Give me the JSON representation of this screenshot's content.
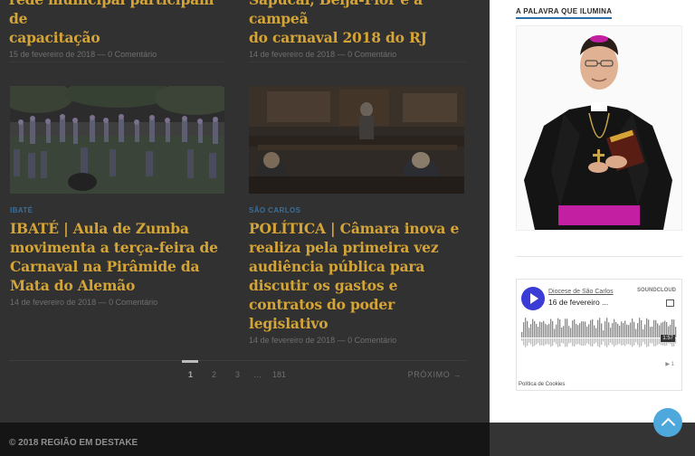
{
  "posts_top": [
    {
      "title_line1": "rede municipal participam de",
      "title_line2": "capacitação",
      "meta": "15 de fevereiro de 2018 — 0 Comentário"
    },
    {
      "title_line1": "Sapucaí, Beija-Flor é a campeã",
      "title_line2": "do carnaval 2018 do RJ",
      "meta": "14 de fevereiro de 2018 — 0 Comentário"
    }
  ],
  "posts": [
    {
      "category": "IBATÉ",
      "title": "IBATÉ | Aula de Zumba movimenta a terça-feira de Carnaval na Pirâmide da Mata do Alemão",
      "meta": "14 de fevereiro de 2018 — 0 Comentário"
    },
    {
      "category": "SÃO CARLOS",
      "title": "POLÍTICA | Câmara inova e realiza pela primeira vez audiência pública para discutir os gastos e contratos do poder legislativo",
      "meta": "14 de fevereiro de 2018 — 0 Comentário"
    }
  ],
  "pagination": {
    "pages": [
      "1",
      "2",
      "3",
      "…",
      "181"
    ],
    "next": "PRÓXIMO →"
  },
  "footer": {
    "copyright": "© 2018 REGIÃO EM DESTAKE"
  },
  "sidebar": {
    "widget_title": "A PALAVRA QUE ILUMINA",
    "soundcloud": {
      "artist": "Diocese de São Carlos",
      "track": "16 de fevereiro ...",
      "brand": "SOUNDCLOUD",
      "duration": "1:57",
      "plays": "▶ 1",
      "cookies": "Política de Cookies"
    }
  },
  "colors": {
    "title": "#d4a437",
    "category": "#3a6f9a",
    "accent": "#2e6ca4",
    "back_to_top": "#4fa8db"
  },
  "icons": [
    "play-icon",
    "share-icon",
    "chevron-up-icon"
  ]
}
